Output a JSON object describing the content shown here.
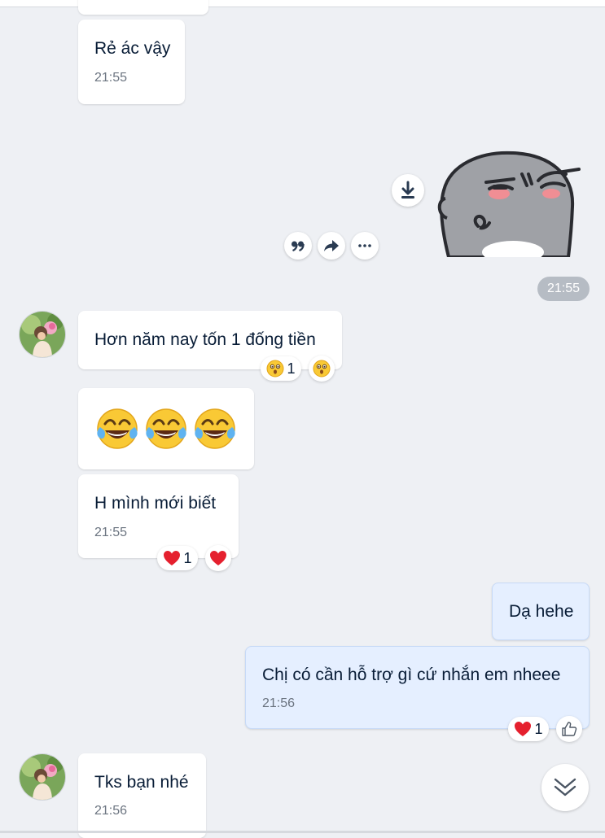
{
  "messages": {
    "m1": {
      "text": "Rẻ ác vậy",
      "time": "21:55"
    },
    "sticker_time": "21:55",
    "m2": {
      "text": "Hơn năm nay tốn 1 đống tiền",
      "reaction_count": "1"
    },
    "m4": {
      "text": "H mình mới biết",
      "time": "21:55",
      "reaction_count": "1"
    },
    "m5": {
      "text": "Dạ hehe"
    },
    "m6": {
      "text": "Chị có cần hỗ trợ gì cứ nhắn em nheee",
      "time": "21:56",
      "reaction_count": "1"
    },
    "m7": {
      "text": "Tks bạn nhé",
      "time": "21:56"
    }
  },
  "colors": {
    "background": "#eef0f4",
    "incoming_bubble": "#ffffff",
    "outgoing_bubble": "#e5efff",
    "heart": "#e5202e"
  },
  "icons": {
    "download": "download-icon",
    "quote": "quote-icon",
    "share": "share-icon",
    "more": "more-icon",
    "like": "thumbs-up-icon",
    "scroll": "scroll-down-icon"
  }
}
